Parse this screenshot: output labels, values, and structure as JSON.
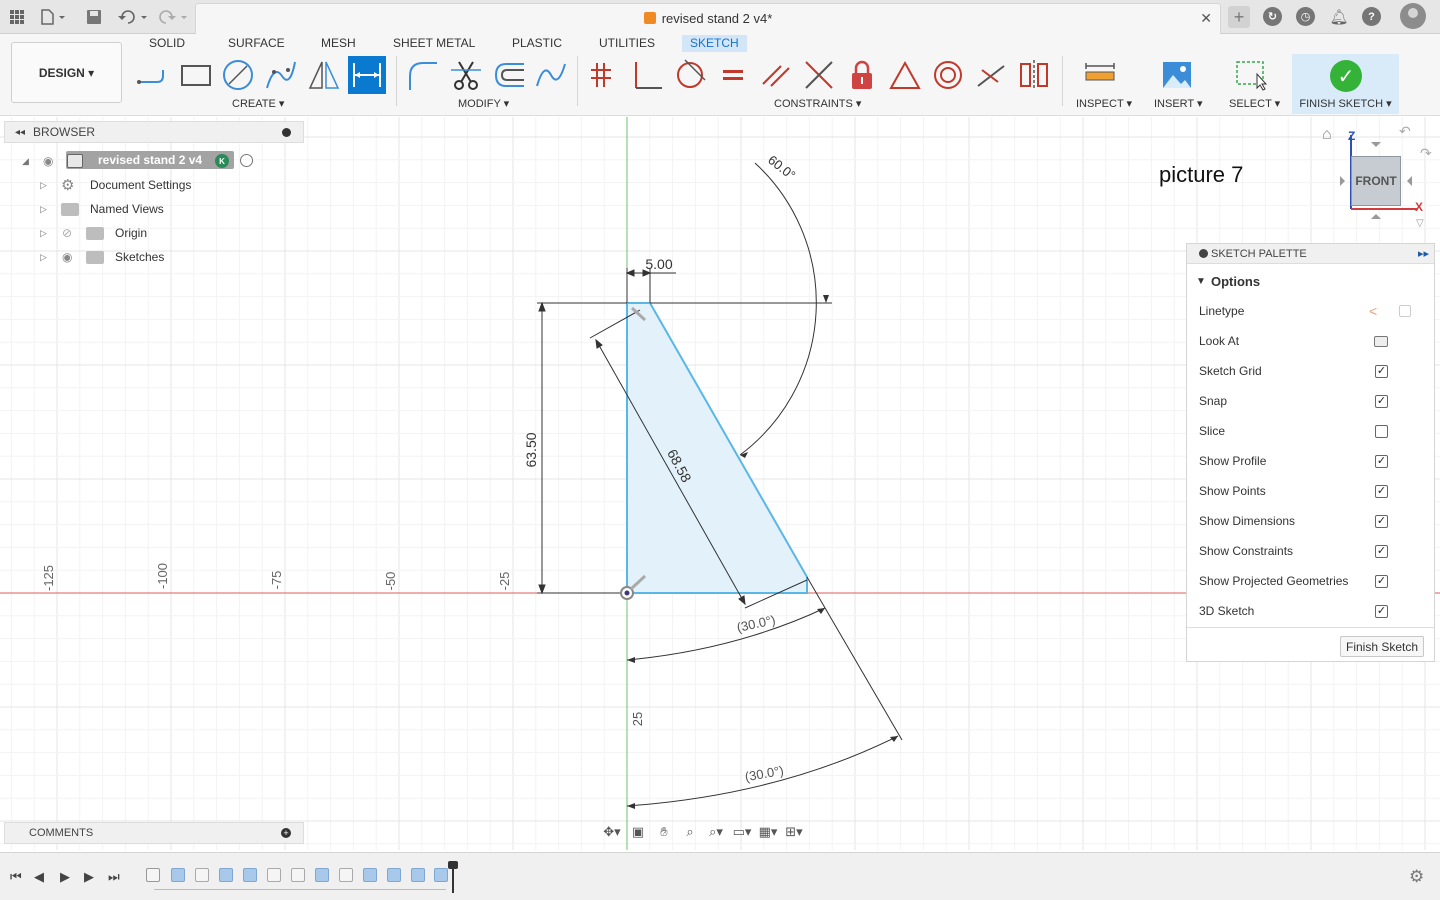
{
  "titlebar": {
    "doc_title": "revised stand 2 v4*",
    "icons": [
      "grid-icon",
      "file-icon",
      "save-icon",
      "undo-icon",
      "redo-icon",
      "close-icon",
      "new-tab-icon",
      "extensions-icon",
      "job-status-icon",
      "notifications-icon",
      "help-icon",
      "avatar"
    ]
  },
  "ribbon": {
    "workspace": "DESIGN",
    "tabs": [
      "SOLID",
      "SURFACE",
      "MESH",
      "SHEET METAL",
      "PLASTIC",
      "UTILITIES",
      "SKETCH"
    ],
    "active_tab": "SKETCH",
    "groups": {
      "create": "CREATE",
      "modify": "MODIFY",
      "constraints": "CONSTRAINTS",
      "inspect": "INSPECT",
      "insert": "INSERT",
      "select": "SELECT",
      "finish": "FINISH SKETCH"
    }
  },
  "browser": {
    "title": "BROWSER",
    "root": "revised stand 2 v4",
    "root_badge": "K",
    "items": [
      "Document Settings",
      "Named Views",
      "Origin",
      "Sketches"
    ]
  },
  "canvas": {
    "picture_label": "picture 7",
    "dimensions": {
      "top_width": "5.00",
      "height": "63.50",
      "hypotenuse": "68.58",
      "angle_top": "60.0°",
      "angle_mid": "(30.0°)",
      "angle_bottom": "(30.0°)",
      "vertical_offset": "25"
    },
    "ruler_labels": [
      "-125",
      "-100",
      "-75",
      "-50",
      "-25"
    ]
  },
  "viewcube": {
    "face": "FRONT",
    "axis_z": "Z",
    "axis_x": "X"
  },
  "palette": {
    "title": "SKETCH PALETTE",
    "section": "Options",
    "rows": [
      {
        "label": "Linetype",
        "type": "icons"
      },
      {
        "label": "Look At",
        "type": "icon"
      },
      {
        "label": "Sketch Grid",
        "checked": true
      },
      {
        "label": "Snap",
        "checked": true
      },
      {
        "label": "Slice",
        "checked": false
      },
      {
        "label": "Show Profile",
        "checked": true
      },
      {
        "label": "Show Points",
        "checked": true
      },
      {
        "label": "Show Dimensions",
        "checked": true
      },
      {
        "label": "Show Constraints",
        "checked": true
      },
      {
        "label": "Show Projected Geometries",
        "checked": true
      },
      {
        "label": "3D Sketch",
        "checked": true
      }
    ],
    "finish_button": "Finish Sketch"
  },
  "comments": {
    "title": "COMMENTS"
  },
  "colors": {
    "accent_blue": "#0a7ad1",
    "sketch_line": "#59b7e6",
    "profile_fill": "#e3f1fb",
    "x_axis": "#e25b5b",
    "y_axis": "#6cc36c",
    "finish_green": "#35b338"
  }
}
